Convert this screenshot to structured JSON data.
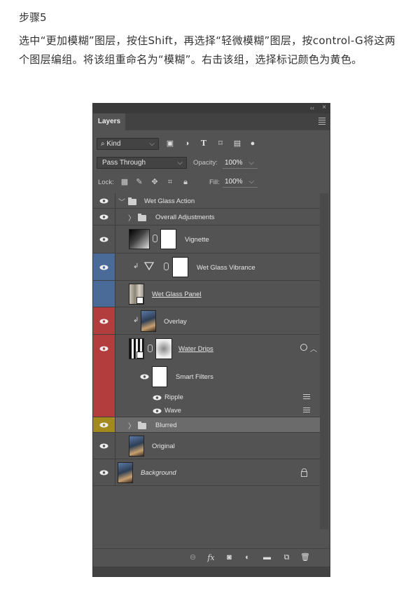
{
  "doc": {
    "step": "步骤5",
    "instruction": "选中“更加模糊”图层，按住Shift，再选择“轻微模糊”图层，按control-G将这两个图层编组。将该组重命名为“模糊”。右击该组，选择标记颜色为黄色。"
  },
  "panel": {
    "tab": "Layers",
    "collapse_glyph": "‹‹",
    "close_glyph": "×",
    "kind_label": "Kind",
    "blend_mode": "Pass Through",
    "opacity_label": "Opacity:",
    "opacity_value": "100%",
    "lock_label": "Lock:",
    "fill_label": "Fill:",
    "fill_value": "100%"
  },
  "colors": {
    "panel_bg": "#535353",
    "selected_row": "#6b6b6b",
    "tag_blue": "#4a6b97",
    "tag_red": "#b33d3d",
    "tag_yellow": "#a38a1d"
  },
  "layers": [
    {
      "name": "Wet Glass Action",
      "kind": "group"
    },
    {
      "name": "Overall Adjustments",
      "kind": "group"
    },
    {
      "name": "Vignette",
      "kind": "adjustment"
    },
    {
      "name": "Wet Glass Vibrance",
      "kind": "adjustment",
      "tag": "blue"
    },
    {
      "name": "Wet Glass Panel",
      "kind": "smart-object",
      "tag": "blue"
    },
    {
      "name": "Overlay",
      "kind": "image",
      "tag": "red"
    },
    {
      "name": "Water Drips",
      "kind": "smart-object",
      "tag": "red"
    },
    {
      "name": "Smart Filters",
      "kind": "filter-mask",
      "tag": "red"
    },
    {
      "name": "Ripple",
      "kind": "filter",
      "tag": "red"
    },
    {
      "name": "Wave",
      "kind": "filter",
      "tag": "red"
    },
    {
      "name": "Blurred",
      "kind": "group",
      "tag": "yellow",
      "selected": true
    },
    {
      "name": "Original",
      "kind": "image"
    },
    {
      "name": "Background",
      "kind": "background",
      "locked": true
    }
  ],
  "bottom_icons": [
    "link-icon",
    "fx-icon",
    "mask-icon",
    "adjustment-icon",
    "new-group-icon",
    "new-layer-icon",
    "trash-icon"
  ],
  "bottom_fx_label": "fx"
}
